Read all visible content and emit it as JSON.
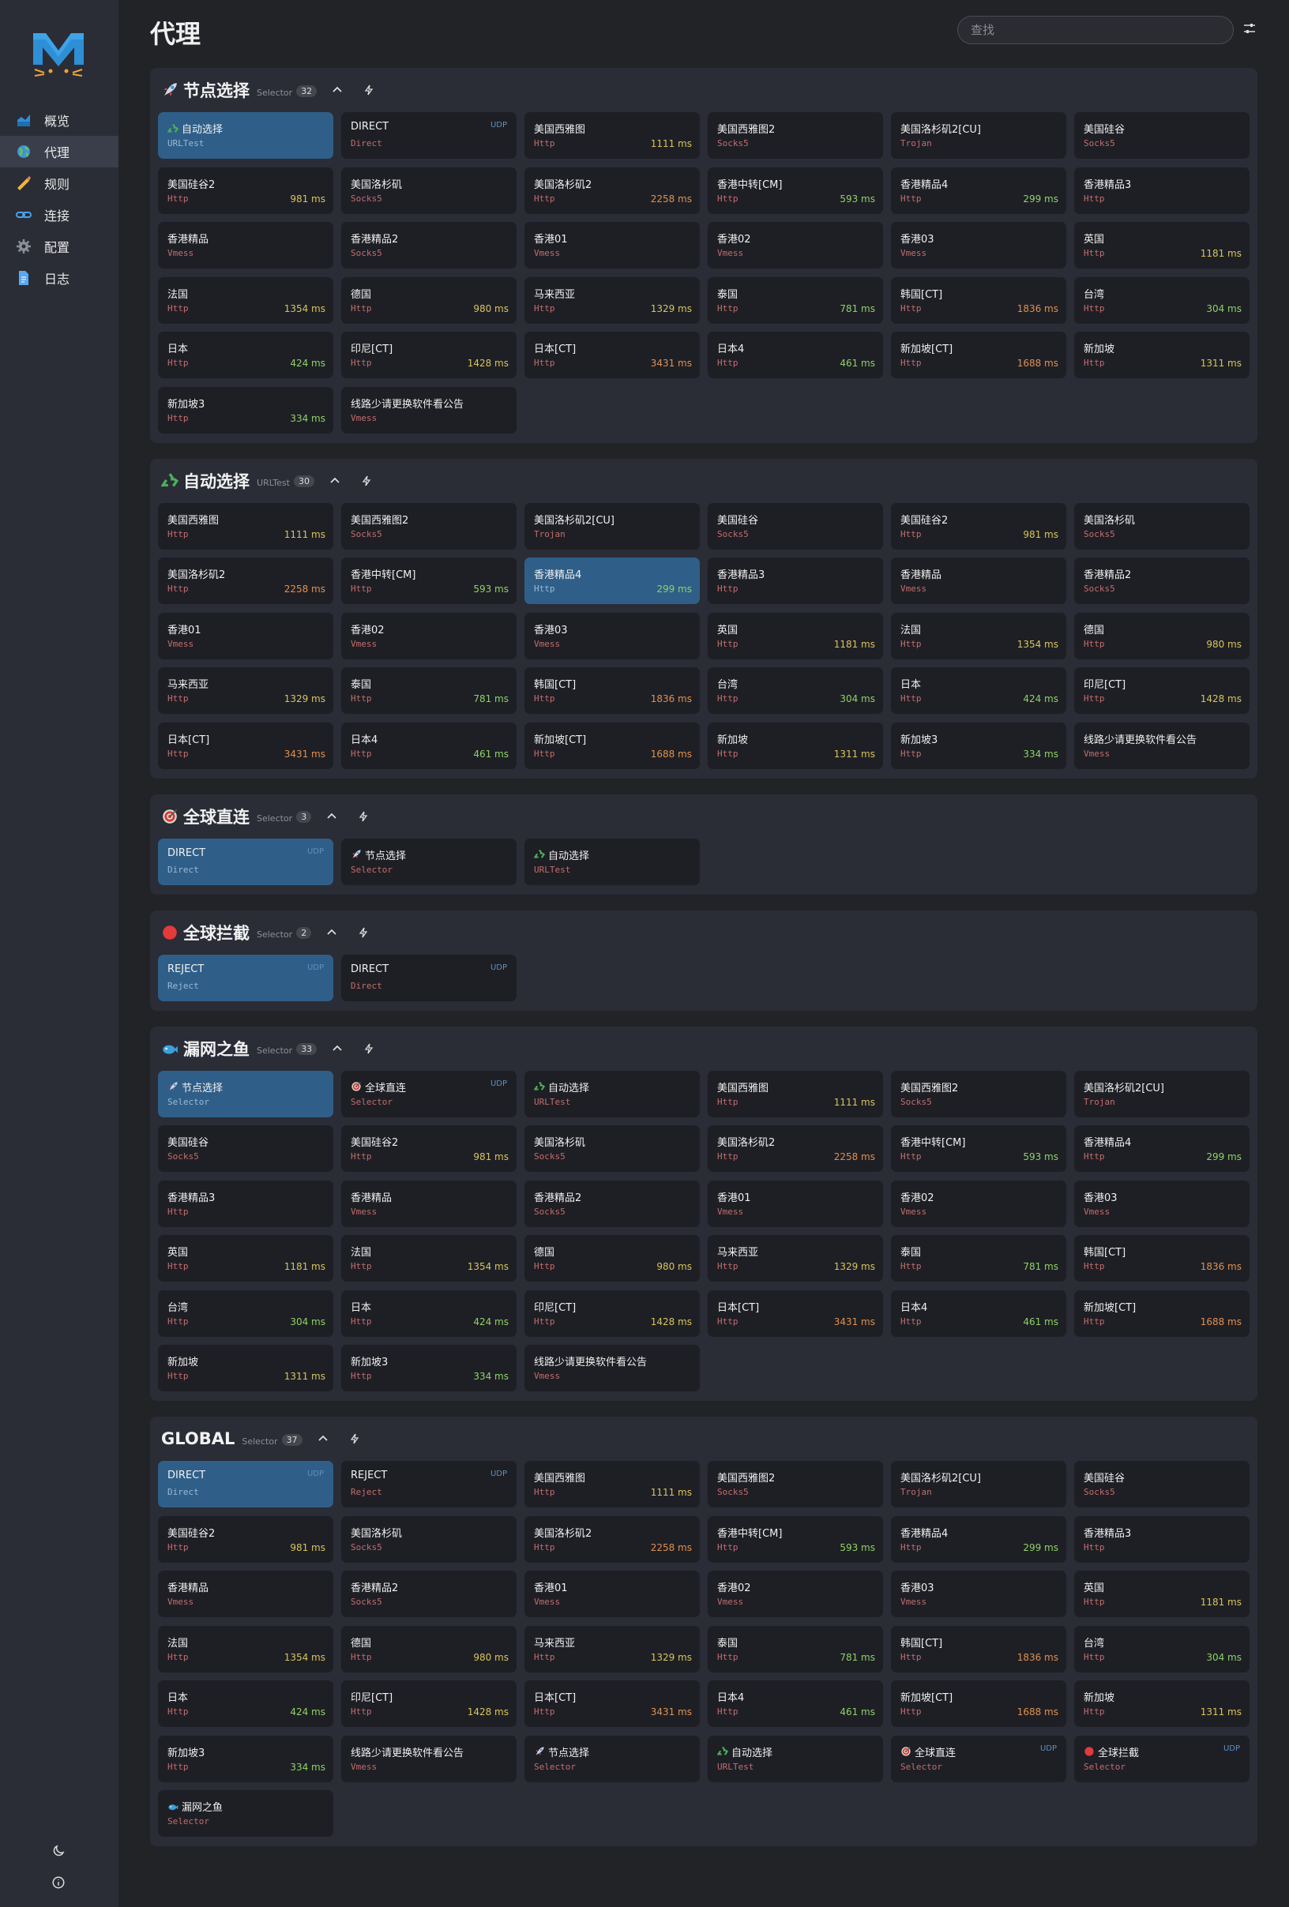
{
  "sidebar": {
    "items": [
      {
        "label": "概览",
        "icon": "chart-icon",
        "active": false
      },
      {
        "label": "代理",
        "icon": "globe-icon",
        "active": true
      },
      {
        "label": "规则",
        "icon": "ruler-icon",
        "active": false
      },
      {
        "label": "连接",
        "icon": "link-icon",
        "active": false
      },
      {
        "label": "配置",
        "icon": "gear-icon",
        "active": false
      },
      {
        "label": "日志",
        "icon": "document-icon",
        "active": false
      }
    ]
  },
  "header": {
    "title": "代理",
    "search_placeholder": "查找"
  },
  "groups": [
    {
      "name": "节点选择",
      "type": "Selector",
      "count": "32",
      "icon": "rocket",
      "proxies": [
        {
          "name": "自动选择",
          "type": "URLTest",
          "icon": "recycle",
          "selected": true
        },
        {
          "name": "DIRECT",
          "type": "Direct",
          "udp": "UDP"
        },
        {
          "name": "美国西雅图",
          "type": "Http",
          "delay": "1111 ms",
          "level": "yellow"
        },
        {
          "name": "美国西雅图2",
          "type": "Socks5"
        },
        {
          "name": "美国洛杉矶2[CU]",
          "type": "Trojan"
        },
        {
          "name": "美国硅谷",
          "type": "Socks5"
        },
        {
          "name": "美国硅谷2",
          "type": "Http",
          "delay": "981 ms",
          "level": "yellow"
        },
        {
          "name": "美国洛杉矶",
          "type": "Socks5"
        },
        {
          "name": "美国洛杉矶2",
          "type": "Http",
          "delay": "2258 ms",
          "level": "orange"
        },
        {
          "name": "香港中转[CM]",
          "type": "Http",
          "delay": "593 ms",
          "level": "green"
        },
        {
          "name": "香港精品4",
          "type": "Http",
          "delay": "299 ms",
          "level": "green"
        },
        {
          "name": "香港精品3",
          "type": "Http"
        },
        {
          "name": "香港精品",
          "type": "Vmess"
        },
        {
          "name": "香港精品2",
          "type": "Socks5"
        },
        {
          "name": "香港01",
          "type": "Vmess"
        },
        {
          "name": "香港02",
          "type": "Vmess"
        },
        {
          "name": "香港03",
          "type": "Vmess"
        },
        {
          "name": "英国",
          "type": "Http",
          "delay": "1181 ms",
          "level": "yellow"
        },
        {
          "name": "法国",
          "type": "Http",
          "delay": "1354 ms",
          "level": "yellow"
        },
        {
          "name": "德国",
          "type": "Http",
          "delay": "980 ms",
          "level": "yellow"
        },
        {
          "name": "马来西亚",
          "type": "Http",
          "delay": "1329 ms",
          "level": "yellow"
        },
        {
          "name": "泰国",
          "type": "Http",
          "delay": "781 ms",
          "level": "green"
        },
        {
          "name": "韩国[CT]",
          "type": "Http",
          "delay": "1836 ms",
          "level": "orange"
        },
        {
          "name": "台湾",
          "type": "Http",
          "delay": "304 ms",
          "level": "green"
        },
        {
          "name": "日本",
          "type": "Http",
          "delay": "424 ms",
          "level": "green"
        },
        {
          "name": "印尼[CT]",
          "type": "Http",
          "delay": "1428 ms",
          "level": "yellow"
        },
        {
          "name": "日本[CT]",
          "type": "Http",
          "delay": "3431 ms",
          "level": "orange"
        },
        {
          "name": "日本4",
          "type": "Http",
          "delay": "461 ms",
          "level": "green"
        },
        {
          "name": "新加坡[CT]",
          "type": "Http",
          "delay": "1688 ms",
          "level": "orange"
        },
        {
          "name": "新加坡",
          "type": "Http",
          "delay": "1311 ms",
          "level": "yellow"
        },
        {
          "name": "新加坡3",
          "type": "Http",
          "delay": "334 ms",
          "level": "green"
        },
        {
          "name": "线路少请更换软件看公告",
          "type": "Vmess"
        }
      ]
    },
    {
      "name": "自动选择",
      "type": "URLTest",
      "count": "30",
      "icon": "recycle",
      "proxies": [
        {
          "name": "美国西雅图",
          "type": "Http",
          "delay": "1111 ms",
          "level": "yellow"
        },
        {
          "name": "美国西雅图2",
          "type": "Socks5"
        },
        {
          "name": "美国洛杉矶2[CU]",
          "type": "Trojan"
        },
        {
          "name": "美国硅谷",
          "type": "Socks5"
        },
        {
          "name": "美国硅谷2",
          "type": "Http",
          "delay": "981 ms",
          "level": "yellow"
        },
        {
          "name": "美国洛杉矶",
          "type": "Socks5"
        },
        {
          "name": "美国洛杉矶2",
          "type": "Http",
          "delay": "2258 ms",
          "level": "orange"
        },
        {
          "name": "香港中转[CM]",
          "type": "Http",
          "delay": "593 ms",
          "level": "green"
        },
        {
          "name": "香港精品4",
          "type": "Http",
          "delay": "299 ms",
          "level": "green",
          "selected": true
        },
        {
          "name": "香港精品3",
          "type": "Http"
        },
        {
          "name": "香港精品",
          "type": "Vmess"
        },
        {
          "name": "香港精品2",
          "type": "Socks5"
        },
        {
          "name": "香港01",
          "type": "Vmess"
        },
        {
          "name": "香港02",
          "type": "Vmess"
        },
        {
          "name": "香港03",
          "type": "Vmess"
        },
        {
          "name": "英国",
          "type": "Http",
          "delay": "1181 ms",
          "level": "yellow"
        },
        {
          "name": "法国",
          "type": "Http",
          "delay": "1354 ms",
          "level": "yellow"
        },
        {
          "name": "德国",
          "type": "Http",
          "delay": "980 ms",
          "level": "yellow"
        },
        {
          "name": "马来西亚",
          "type": "Http",
          "delay": "1329 ms",
          "level": "yellow"
        },
        {
          "name": "泰国",
          "type": "Http",
          "delay": "781 ms",
          "level": "green"
        },
        {
          "name": "韩国[CT]",
          "type": "Http",
          "delay": "1836 ms",
          "level": "orange"
        },
        {
          "name": "台湾",
          "type": "Http",
          "delay": "304 ms",
          "level": "green"
        },
        {
          "name": "日本",
          "type": "Http",
          "delay": "424 ms",
          "level": "green"
        },
        {
          "name": "印尼[CT]",
          "type": "Http",
          "delay": "1428 ms",
          "level": "yellow"
        },
        {
          "name": "日本[CT]",
          "type": "Http",
          "delay": "3431 ms",
          "level": "orange"
        },
        {
          "name": "日本4",
          "type": "Http",
          "delay": "461 ms",
          "level": "green"
        },
        {
          "name": "新加坡[CT]",
          "type": "Http",
          "delay": "1688 ms",
          "level": "orange"
        },
        {
          "name": "新加坡",
          "type": "Http",
          "delay": "1311 ms",
          "level": "yellow"
        },
        {
          "name": "新加坡3",
          "type": "Http",
          "delay": "334 ms",
          "level": "green"
        },
        {
          "name": "线路少请更换软件看公告",
          "type": "Vmess"
        }
      ]
    },
    {
      "name": "全球直连",
      "type": "Selector",
      "count": "3",
      "icon": "target",
      "proxies": [
        {
          "name": "DIRECT",
          "type": "Direct",
          "udp": "UDP",
          "selected": true
        },
        {
          "name": "节点选择",
          "type": "Selector",
          "icon": "rocket"
        },
        {
          "name": "自动选择",
          "type": "URLTest",
          "icon": "recycle"
        }
      ]
    },
    {
      "name": "全球拦截",
      "type": "Selector",
      "count": "2",
      "icon": "stop",
      "proxies": [
        {
          "name": "REJECT",
          "type": "Reject",
          "udp": "UDP",
          "selected": true
        },
        {
          "name": "DIRECT",
          "type": "Direct",
          "udp": "UDP"
        }
      ]
    },
    {
      "name": "漏网之鱼",
      "type": "Selector",
      "count": "33",
      "icon": "fish",
      "proxies": [
        {
          "name": "节点选择",
          "type": "Selector",
          "icon": "rocket",
          "selected": true
        },
        {
          "name": "全球直连",
          "type": "Selector",
          "icon": "target",
          "udp": "UDP"
        },
        {
          "name": "自动选择",
          "type": "URLTest",
          "icon": "recycle"
        },
        {
          "name": "美国西雅图",
          "type": "Http",
          "delay": "1111 ms",
          "level": "yellow"
        },
        {
          "name": "美国西雅图2",
          "type": "Socks5"
        },
        {
          "name": "美国洛杉矶2[CU]",
          "type": "Trojan"
        },
        {
          "name": "美国硅谷",
          "type": "Socks5"
        },
        {
          "name": "美国硅谷2",
          "type": "Http",
          "delay": "981 ms",
          "level": "yellow"
        },
        {
          "name": "美国洛杉矶",
          "type": "Socks5"
        },
        {
          "name": "美国洛杉矶2",
          "type": "Http",
          "delay": "2258 ms",
          "level": "orange"
        },
        {
          "name": "香港中转[CM]",
          "type": "Http",
          "delay": "593 ms",
          "level": "green"
        },
        {
          "name": "香港精品4",
          "type": "Http",
          "delay": "299 ms",
          "level": "green"
        },
        {
          "name": "香港精品3",
          "type": "Http"
        },
        {
          "name": "香港精品",
          "type": "Vmess"
        },
        {
          "name": "香港精品2",
          "type": "Socks5"
        },
        {
          "name": "香港01",
          "type": "Vmess"
        },
        {
          "name": "香港02",
          "type": "Vmess"
        },
        {
          "name": "香港03",
          "type": "Vmess"
        },
        {
          "name": "英国",
          "type": "Http",
          "delay": "1181 ms",
          "level": "yellow"
        },
        {
          "name": "法国",
          "type": "Http",
          "delay": "1354 ms",
          "level": "yellow"
        },
        {
          "name": "德国",
          "type": "Http",
          "delay": "980 ms",
          "level": "yellow"
        },
        {
          "name": "马来西亚",
          "type": "Http",
          "delay": "1329 ms",
          "level": "yellow"
        },
        {
          "name": "泰国",
          "type": "Http",
          "delay": "781 ms",
          "level": "green"
        },
        {
          "name": "韩国[CT]",
          "type": "Http",
          "delay": "1836 ms",
          "level": "orange"
        },
        {
          "name": "台湾",
          "type": "Http",
          "delay": "304 ms",
          "level": "green"
        },
        {
          "name": "日本",
          "type": "Http",
          "delay": "424 ms",
          "level": "green"
        },
        {
          "name": "印尼[CT]",
          "type": "Http",
          "delay": "1428 ms",
          "level": "yellow"
        },
        {
          "name": "日本[CT]",
          "type": "Http",
          "delay": "3431 ms",
          "level": "orange"
        },
        {
          "name": "日本4",
          "type": "Http",
          "delay": "461 ms",
          "level": "green"
        },
        {
          "name": "新加坡[CT]",
          "type": "Http",
          "delay": "1688 ms",
          "level": "orange"
        },
        {
          "name": "新加坡",
          "type": "Http",
          "delay": "1311 ms",
          "level": "yellow"
        },
        {
          "name": "新加坡3",
          "type": "Http",
          "delay": "334 ms",
          "level": "green"
        },
        {
          "name": "线路少请更换软件看公告",
          "type": "Vmess"
        }
      ]
    },
    {
      "name": "GLOBAL",
      "type": "Selector",
      "count": "37",
      "icon": "",
      "proxies": [
        {
          "name": "DIRECT",
          "type": "Direct",
          "udp": "UDP",
          "selected": true
        },
        {
          "name": "REJECT",
          "type": "Reject",
          "udp": "UDP"
        },
        {
          "name": "美国西雅图",
          "type": "Http",
          "delay": "1111 ms",
          "level": "yellow"
        },
        {
          "name": "美国西雅图2",
          "type": "Socks5"
        },
        {
          "name": "美国洛杉矶2[CU]",
          "type": "Trojan"
        },
        {
          "name": "美国硅谷",
          "type": "Socks5"
        },
        {
          "name": "美国硅谷2",
          "type": "Http",
          "delay": "981 ms",
          "level": "yellow"
        },
        {
          "name": "美国洛杉矶",
          "type": "Socks5"
        },
        {
          "name": "美国洛杉矶2",
          "type": "Http",
          "delay": "2258 ms",
          "level": "orange"
        },
        {
          "name": "香港中转[CM]",
          "type": "Http",
          "delay": "593 ms",
          "level": "green"
        },
        {
          "name": "香港精品4",
          "type": "Http",
          "delay": "299 ms",
          "level": "green"
        },
        {
          "name": "香港精品3",
          "type": "Http"
        },
        {
          "name": "香港精品",
          "type": "Vmess"
        },
        {
          "name": "香港精品2",
          "type": "Socks5"
        },
        {
          "name": "香港01",
          "type": "Vmess"
        },
        {
          "name": "香港02",
          "type": "Vmess"
        },
        {
          "name": "香港03",
          "type": "Vmess"
        },
        {
          "name": "英国",
          "type": "Http",
          "delay": "1181 ms",
          "level": "yellow"
        },
        {
          "name": "法国",
          "type": "Http",
          "delay": "1354 ms",
          "level": "yellow"
        },
        {
          "name": "德国",
          "type": "Http",
          "delay": "980 ms",
          "level": "yellow"
        },
        {
          "name": "马来西亚",
          "type": "Http",
          "delay": "1329 ms",
          "level": "yellow"
        },
        {
          "name": "泰国",
          "type": "Http",
          "delay": "781 ms",
          "level": "green"
        },
        {
          "name": "韩国[CT]",
          "type": "Http",
          "delay": "1836 ms",
          "level": "orange"
        },
        {
          "name": "台湾",
          "type": "Http",
          "delay": "304 ms",
          "level": "green"
        },
        {
          "name": "日本",
          "type": "Http",
          "delay": "424 ms",
          "level": "green"
        },
        {
          "name": "印尼[CT]",
          "type": "Http",
          "delay": "1428 ms",
          "level": "yellow"
        },
        {
          "name": "日本[CT]",
          "type": "Http",
          "delay": "3431 ms",
          "level": "orange"
        },
        {
          "name": "日本4",
          "type": "Http",
          "delay": "461 ms",
          "level": "green"
        },
        {
          "name": "新加坡[CT]",
          "type": "Http",
          "delay": "1688 ms",
          "level": "orange"
        },
        {
          "name": "新加坡",
          "type": "Http",
          "delay": "1311 ms",
          "level": "yellow"
        },
        {
          "name": "新加坡3",
          "type": "Http",
          "delay": "334 ms",
          "level": "green"
        },
        {
          "name": "线路少请更换软件看公告",
          "type": "Vmess"
        },
        {
          "name": "节点选择",
          "type": "Selector",
          "icon": "rocket"
        },
        {
          "name": "自动选择",
          "type": "URLTest",
          "icon": "recycle"
        },
        {
          "name": "全球直连",
          "type": "Selector",
          "icon": "target",
          "udp": "UDP"
        },
        {
          "name": "全球拦截",
          "type": "Selector",
          "icon": "stop",
          "udp": "UDP"
        },
        {
          "name": "漏网之鱼",
          "type": "Selector",
          "icon": "fish"
        }
      ]
    }
  ]
}
